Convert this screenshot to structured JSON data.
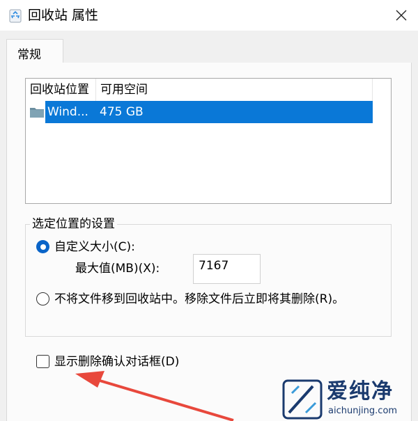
{
  "window": {
    "title": "回收站 属性",
    "icon": "recycle-bin-icon"
  },
  "tabs": [
    {
      "label": "常规",
      "selected": true
    }
  ],
  "listview": {
    "columns": [
      "回收站位置",
      "可用空间"
    ],
    "rows": [
      {
        "name": "Wind...",
        "space": "475 GB",
        "icon": "folder-icon",
        "selected": true
      }
    ]
  },
  "settings": {
    "group_title": "选定位置的设置",
    "custom_size_label": "自定义大小(C):",
    "custom_size_checked": true,
    "max_size_label": "最大值(MB)(X):",
    "max_size_value": "7167",
    "no_move_label": "不将文件移到回收站中。移除文件后立即将其删除(R)。",
    "no_move_checked": false
  },
  "confirm": {
    "label": "显示删除确认对话框(D)",
    "checked": false
  },
  "watermark": {
    "title": "爱纯净",
    "url": "aichunjing.com"
  },
  "colors": {
    "selection": "#0a78d7",
    "radio_checked": "#0a64c8",
    "arrow": "#e8483c",
    "watermark": "#1a3a6e"
  }
}
